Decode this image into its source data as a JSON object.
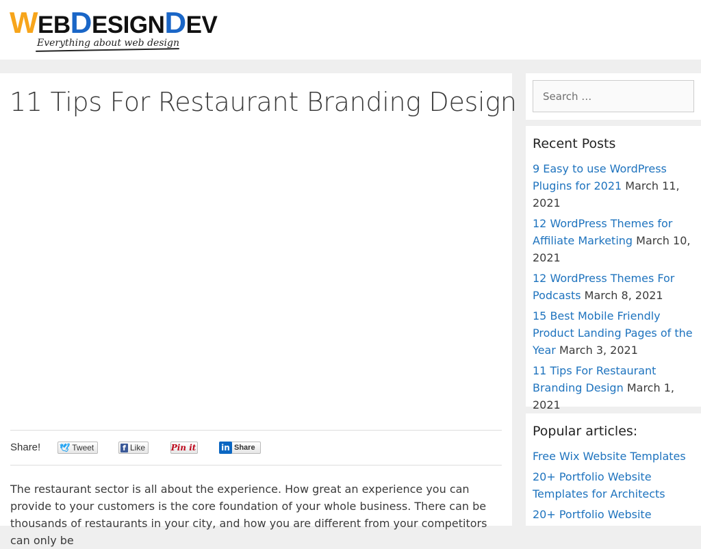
{
  "header": {
    "logo": {
      "parts": [
        "W",
        "EB",
        "D",
        "ESIGN",
        "D",
        "EV"
      ],
      "tagline": "Everything about web design"
    }
  },
  "post": {
    "title": "11 Tips For Restaurant Branding Design",
    "share": {
      "label": "Share!",
      "tweet": "Tweet",
      "like": "Like",
      "pin": "Pin it",
      "share": "Share"
    },
    "intro": "The restaurant sector is all about the experience. How great an experience you can provide to your customers is the core foundation of your whole business. There can be thousands of restaurants in your city, and how you are different from your competitors can only be"
  },
  "sidebar": {
    "search": {
      "placeholder": "Search …"
    },
    "recent": {
      "title": "Recent Posts",
      "items": [
        {
          "link": "9 Easy to use WordPress Plugins for 2021",
          "date": "March 11, 2021"
        },
        {
          "link": "12 WordPress Themes for Affiliate Marketing",
          "date": "March 10, 2021"
        },
        {
          "link": "12 WordPress Themes For Podcasts",
          "date": "March 8, 2021"
        },
        {
          "link": "15 Best Mobile Friendly Product Landing Pages of the Year",
          "date": "March 3, 2021"
        },
        {
          "link": "11 Tips For Restaurant Branding Design",
          "date": "March 1, 2021"
        }
      ]
    },
    "popular": {
      "title": "Popular articles:",
      "items": [
        "Free Wix Website Templates",
        "20+ Portfolio Website Templates for Architects",
        "20+ Portfolio Website"
      ]
    }
  },
  "colors": {
    "link": "#1e73be",
    "text": "#3a3a3a",
    "page_bg": "#efefef",
    "logo_orange": "#f7a51b",
    "logo_blue": "#1a66c7"
  }
}
